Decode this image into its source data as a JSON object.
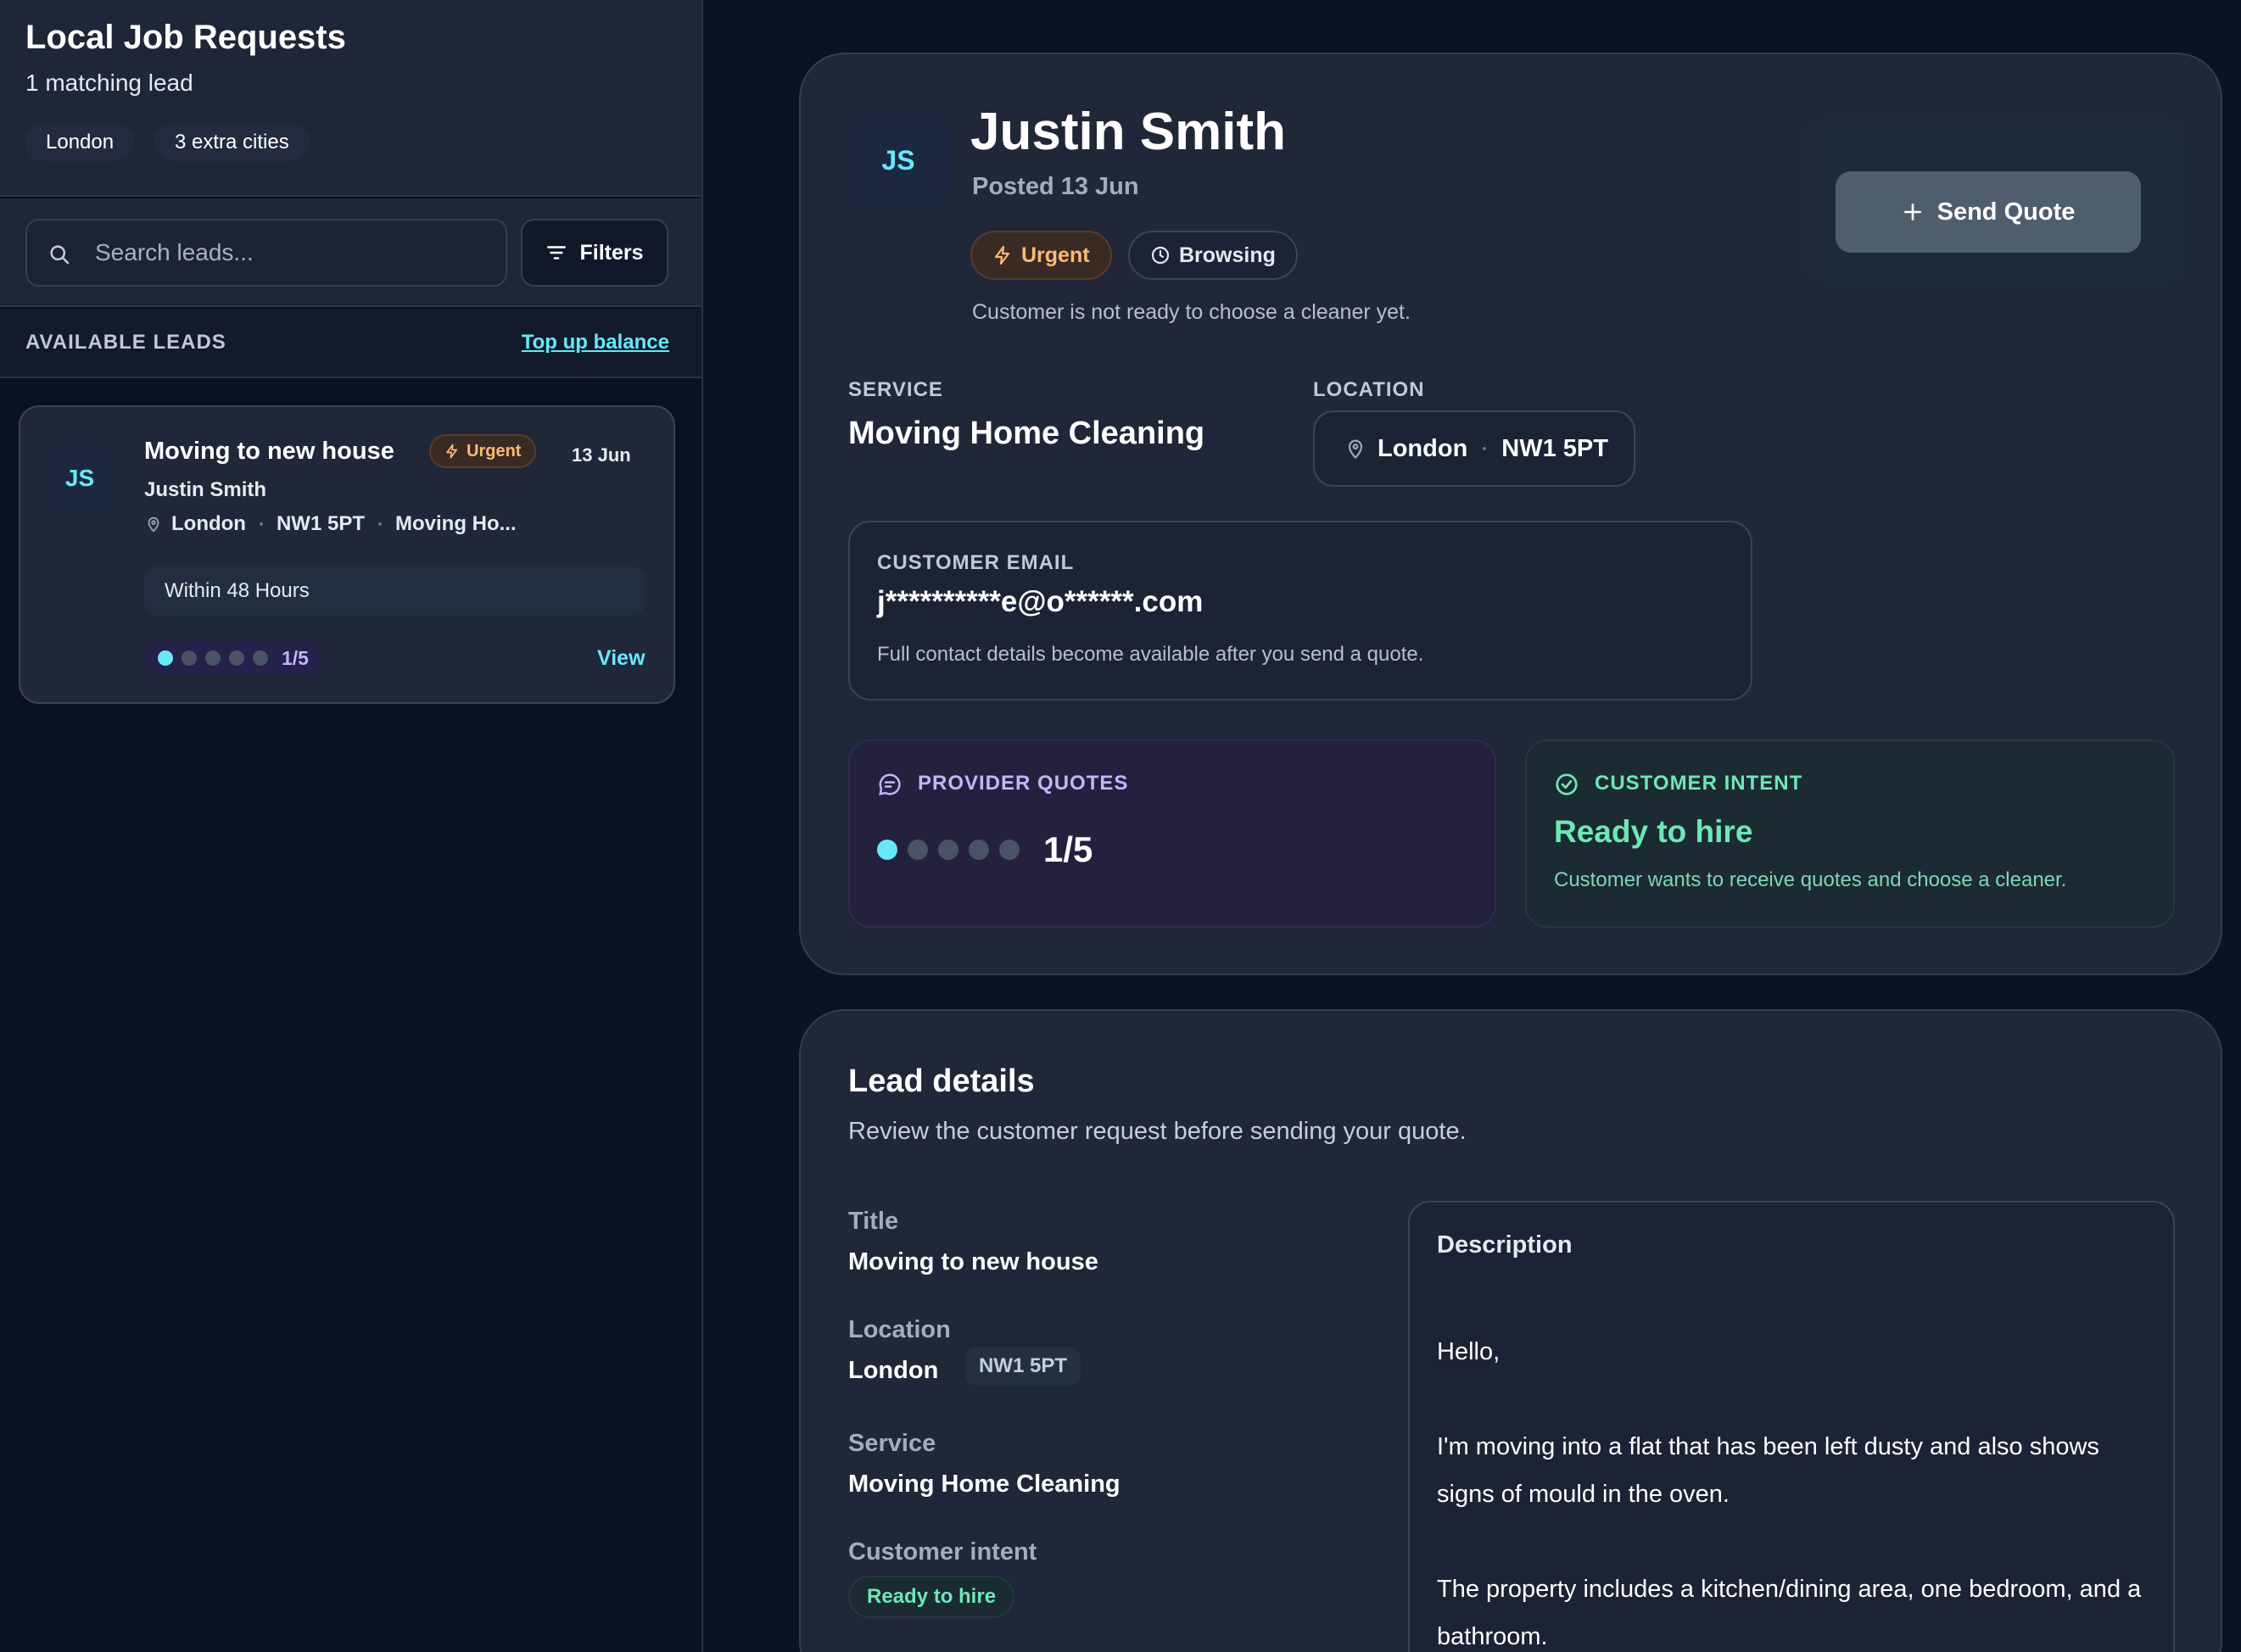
{
  "sidebar": {
    "title": "Local Job Requests",
    "subtitle": "1 matching lead",
    "chips": [
      "London",
      "3 extra cities"
    ],
    "search_placeholder": "Search leads...",
    "filters_label": "Filters",
    "section_label": "AVAILABLE LEADS",
    "topup_label": "Top up balance",
    "lead": {
      "initials": "JS",
      "title": "Moving to new house",
      "urgent_label": "Urgent",
      "date": "13 Jun",
      "customer": "Justin Smith",
      "city": "London",
      "postcode": "NW1 5PT",
      "service_short": "Moving Ho...",
      "timing": "Within 48 Hours",
      "quotes_filled": 1,
      "quotes_total": 5,
      "quotes_label": "1/5",
      "view_label": "View"
    }
  },
  "main": {
    "initials": "JS",
    "name": "Justin Smith",
    "posted": "Posted 13 Jun",
    "urgent_label": "Urgent",
    "browsing_label": "Browsing",
    "note": "Customer is not ready to choose a cleaner yet.",
    "send_quote_label": "Send Quote",
    "service_label": "SERVICE",
    "service_value": "Moving Home Cleaning",
    "location_label": "LOCATION",
    "location_city": "London",
    "location_postcode": "NW1 5PT",
    "email_label": "CUSTOMER EMAIL",
    "email_value": "j**********e@o******.com",
    "email_hint": "Full contact details become available after you send a quote.",
    "provider_quotes_label": "PROVIDER QUOTES",
    "provider_quotes_count": "1/5",
    "intent_label": "CUSTOMER INTENT",
    "intent_value": "Ready to hire",
    "intent_hint": "Customer wants to receive quotes and choose a cleaner."
  },
  "details": {
    "title": "Lead details",
    "subtitle": "Review the customer request before sending your quote.",
    "title_label": "Title",
    "title_value": "Moving to new house",
    "location_label": "Location",
    "location_city": "London",
    "location_postcode": "NW1 5PT",
    "service_label": "Service",
    "service_value": "Moving Home Cleaning",
    "intent_label": "Customer intent",
    "intent_value": "Ready to hire",
    "description_label": "Description",
    "description_paragraphs": [
      "Hello,",
      "I'm moving into a flat that has been left dusty and also shows signs of mould in the oven.",
      "The property includes a kitchen/dining area, one bedroom, and a bathroom."
    ]
  },
  "colors": {
    "accent_cyan": "#67e8f9",
    "urgent_orange": "#fdba74",
    "intent_green": "#6ee7b7",
    "quotes_purple": "#c4b5fd"
  }
}
